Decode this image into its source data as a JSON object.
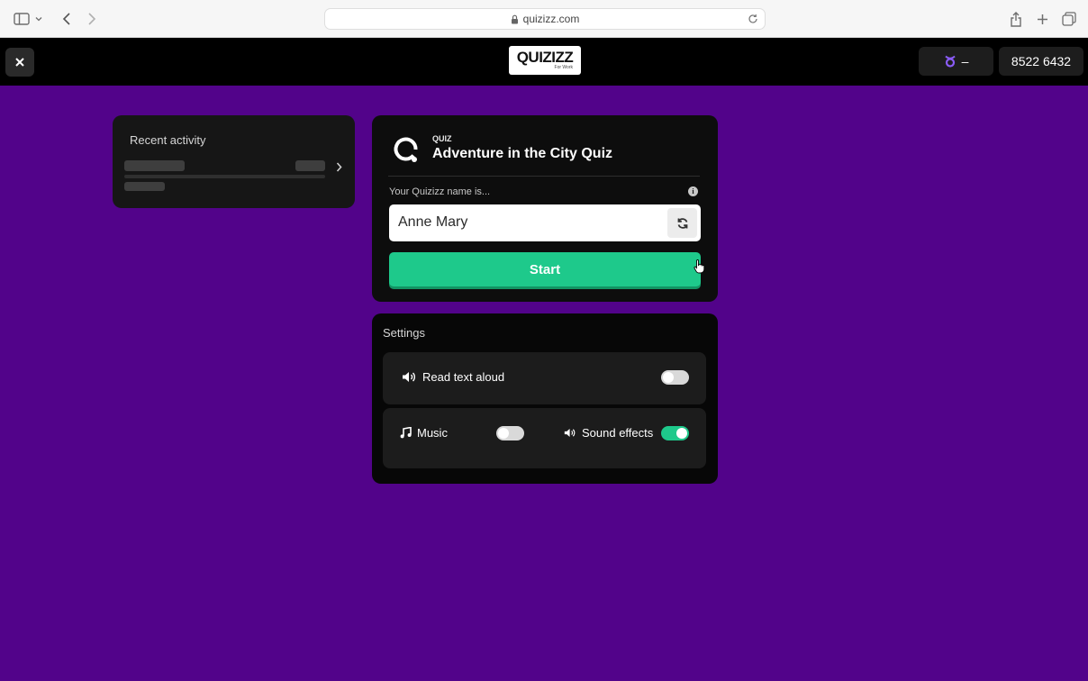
{
  "browser": {
    "url": "quizizz.com"
  },
  "header": {
    "logo_text": "QUIZIZZ",
    "logo_sub": "For Work",
    "avatar_status": "–",
    "join_code": "8522 6432"
  },
  "recent": {
    "title": "Recent activity"
  },
  "quiz": {
    "type_label": "QUIZ",
    "title": "Adventure in the City Quiz",
    "name_label": "Your Quizizz name is...",
    "name_value": "Anne Mary",
    "start_label": "Start"
  },
  "settings": {
    "title": "Settings",
    "read_aloud_label": "Read text aloud",
    "read_aloud_on": false,
    "music_label": "Music",
    "music_on": false,
    "sound_effects_label": "Sound effects",
    "sound_effects_on": true
  },
  "colors": {
    "page_background": "#52038a",
    "accent_green": "#1ec98b",
    "avatar_purple": "#8a5cf5"
  },
  "icons": [
    "sidebar-icon",
    "chevron-down-icon",
    "back-icon",
    "forward-icon",
    "lock-icon",
    "reload-icon",
    "share-icon",
    "new-tab-icon",
    "tabs-icon",
    "close-icon",
    "avatar-icon",
    "chevron-right-icon",
    "quiz-logo-icon",
    "info-icon",
    "regenerate-icon",
    "speaker-icon",
    "music-note-icon"
  ]
}
